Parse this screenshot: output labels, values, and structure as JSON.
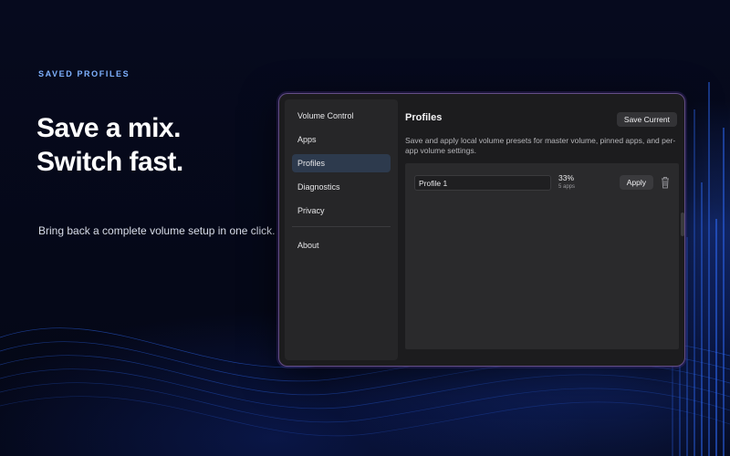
{
  "hero": {
    "eyebrow": "SAVED PROFILES",
    "headline_line1": "Save a mix.",
    "headline_line2": "Switch fast.",
    "subline": "Bring back a complete volume setup in one click."
  },
  "sidebar": {
    "items": [
      {
        "label": "Volume Control",
        "active": false
      },
      {
        "label": "Apps",
        "active": false
      },
      {
        "label": "Profiles",
        "active": true
      },
      {
        "label": "Diagnostics",
        "active": false
      },
      {
        "label": "Privacy",
        "active": false
      }
    ],
    "footer_item": "About"
  },
  "main": {
    "title": "Profiles",
    "save_button": "Save Current",
    "description": "Save and apply local volume presets for master volume, pinned apps, and per-app volume settings.",
    "profiles": [
      {
        "name": "Profile 1",
        "volume": "33%",
        "apps": "5 apps",
        "apply_label": "Apply"
      }
    ]
  },
  "icons": {
    "delete": "trash-icon"
  },
  "colors": {
    "accent": "#7fb2ff",
    "active_nav": "#2d3a4d",
    "background": "#05081a"
  }
}
